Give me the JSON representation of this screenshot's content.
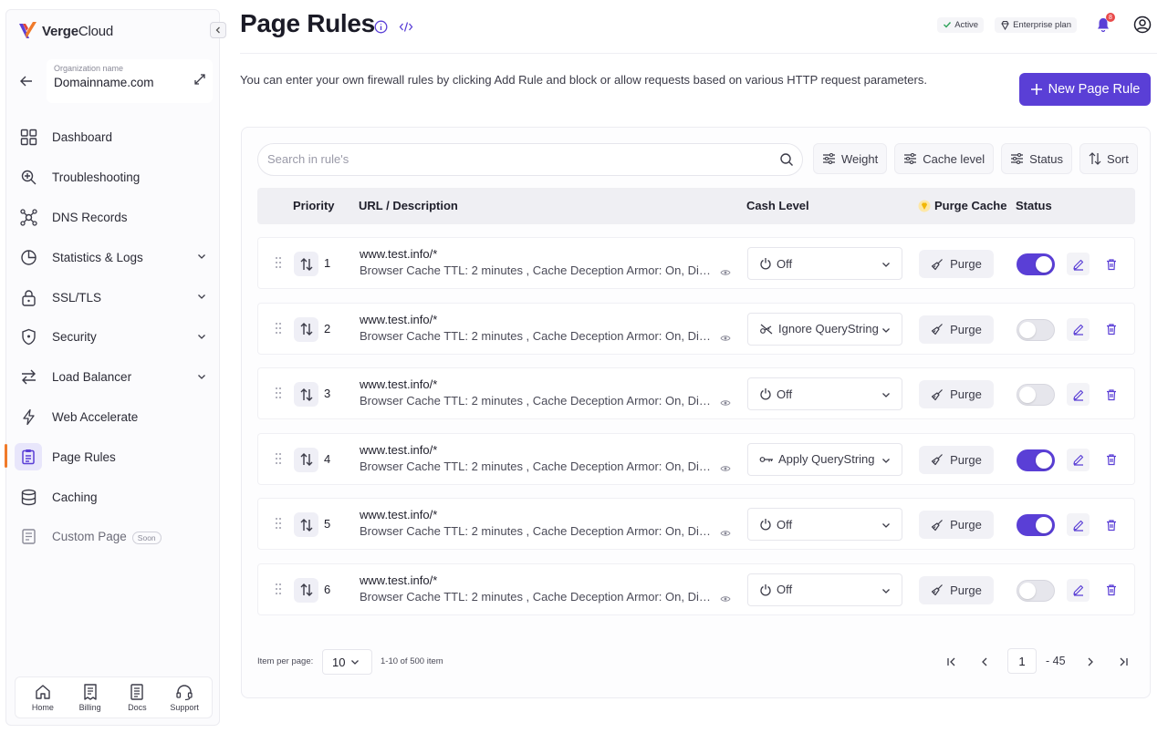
{
  "brand": {
    "name_bold": "Verge",
    "name_light": "Cloud"
  },
  "org": {
    "label": "Organization name",
    "name": "Domainname.com"
  },
  "nav": [
    {
      "label": "Dashboard",
      "icon": "dashboard-icon",
      "chevron": false
    },
    {
      "label": "Troubleshooting",
      "icon": "troubleshooting-icon",
      "chevron": false
    },
    {
      "label": "DNS Records",
      "icon": "dns-icon",
      "chevron": false
    },
    {
      "label": "Statistics &  Logs",
      "icon": "statistics-icon",
      "chevron": true
    },
    {
      "label": "SSL/TLS",
      "icon": "lock-icon",
      "chevron": true
    },
    {
      "label": "Security",
      "icon": "shield-icon",
      "chevron": true
    },
    {
      "label": "Load Balancer",
      "icon": "load-balancer-icon",
      "chevron": true
    },
    {
      "label": "Web Accelerate",
      "icon": "bolt-icon",
      "chevron": false
    },
    {
      "label": "Page Rules",
      "icon": "page-rules-icon",
      "chevron": false,
      "active": true
    },
    {
      "label": "Caching",
      "icon": "database-icon",
      "chevron": false
    },
    {
      "label": "Custom Page",
      "icon": "custom-page-icon",
      "chevron": false,
      "badge": "Soon"
    }
  ],
  "bottom_nav": [
    {
      "label": "Home",
      "icon": "home-icon"
    },
    {
      "label": "Billing",
      "icon": "billing-icon"
    },
    {
      "label": "Docs",
      "icon": "docs-icon"
    },
    {
      "label": "Support",
      "icon": "support-icon"
    }
  ],
  "header": {
    "title": "Page Rules",
    "status_chip": "Active",
    "plan_chip": "Enterprise plan",
    "notifications_count": "8",
    "accent_color": "#5a3fd6",
    "active_marker_color": "#f07a2a"
  },
  "description": "You can enter your own firewall rules by clicking Add Rule and block or allow requests based on various HTTP request parameters.",
  "new_rule_label": "New Page Rule",
  "search": {
    "placeholder": "Search in rule's",
    "value": ""
  },
  "filters": [
    "Weight",
    "Cache level",
    "Status",
    "Sort"
  ],
  "table": {
    "headers": {
      "priority": "Priority",
      "url": "URL / Description",
      "cache": "Cash Level",
      "purge": "Purge Cache",
      "status": "Status"
    },
    "rows": [
      {
        "priority": "1",
        "url": "www.test.info/*",
        "desc": "Browser Cache TTL: 2 minutes , Cache  Deception Armor: On, Disable Apps",
        "cache": "Off",
        "cache_icon": "power-icon",
        "purge": "Purge",
        "enabled": true
      },
      {
        "priority": "2",
        "url": "www.test.info/*",
        "desc": "Browser Cache TTL: 2 minutes , Cache  Deception Armor: On, Disable Apps",
        "cache": "Ignore QueryString",
        "cache_icon": "key-slash-icon",
        "purge": "Purge",
        "enabled": false
      },
      {
        "priority": "3",
        "url": "www.test.info/*",
        "desc": "Browser Cache TTL: 2 minutes , Cache  Deception Armor: On, Disable Apps",
        "cache": "Off",
        "cache_icon": "power-icon",
        "purge": "Purge",
        "enabled": false
      },
      {
        "priority": "4",
        "url": "www.test.info/*",
        "desc": "Browser Cache TTL: 2 minutes , Cache  Deception Armor: On, Disable Apps",
        "cache": "Apply QueryString",
        "cache_icon": "key-icon",
        "purge": "Purge",
        "enabled": true
      },
      {
        "priority": "5",
        "url": "www.test.info/*",
        "desc": "Browser Cache TTL: 2 minutes , Cache  Deception Armor: On, Disable Apps",
        "cache": "Off",
        "cache_icon": "power-icon",
        "purge": "Purge",
        "enabled": true
      },
      {
        "priority": "6",
        "url": "www.test.info/*",
        "desc": "Browser Cache TTL: 2 minutes , Cache  Deception Armor: On, Disable Apps",
        "cache": "Off",
        "cache_icon": "power-icon",
        "purge": "Purge",
        "enabled": false
      }
    ]
  },
  "pagination": {
    "per_page_label": "Item per page:",
    "per_page": "10",
    "range_text": "1-10 of 500 item",
    "current_page": "1",
    "total_pages_text": "- 45"
  }
}
